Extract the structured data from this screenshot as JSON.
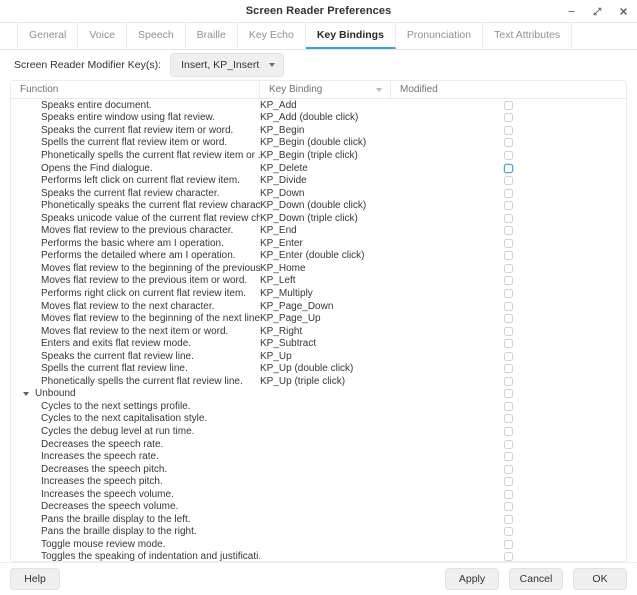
{
  "window": {
    "title": "Screen Reader Preferences",
    "controls": [
      {
        "name": "minimize-button",
        "glyph": "−"
      },
      {
        "name": "maximize-button",
        "glyph": "⤡"
      },
      {
        "name": "close-button",
        "glyph": "✕"
      }
    ]
  },
  "tabs": [
    {
      "label": "General",
      "active": false
    },
    {
      "label": "Voice",
      "active": false
    },
    {
      "label": "Speech",
      "active": false
    },
    {
      "label": "Braille",
      "active": false
    },
    {
      "label": "Key Echo",
      "active": false
    },
    {
      "label": "Key Bindings",
      "active": true
    },
    {
      "label": "Pronunciation",
      "active": false
    },
    {
      "label": "Text Attributes",
      "active": false
    }
  ],
  "modifier": {
    "label": "Screen Reader Modifier Key(s):",
    "value": "Insert, KP_Insert"
  },
  "table": {
    "headers": {
      "function": "Function",
      "key_binding": "Key Binding",
      "modified": "Modified"
    },
    "sort_column": "Key Binding",
    "sort_direction": "descending",
    "rows": [
      {
        "function": "Speaks entire document.",
        "key": "KP_Add",
        "modified": false
      },
      {
        "function": "Speaks entire window using flat review.",
        "key": "KP_Add (double click)",
        "modified": false
      },
      {
        "function": "Speaks the current flat review item or word.",
        "key": "KP_Begin",
        "modified": false
      },
      {
        "function": "Spells the current flat review item or word.",
        "key": "KP_Begin (double click)",
        "modified": false
      },
      {
        "function": "Phonetically spells the current flat review item or ...",
        "key": "KP_Begin (triple click)",
        "modified": false
      },
      {
        "function": "Opens the Find dialogue.",
        "key": "KP_Delete",
        "modified": false,
        "focused": true
      },
      {
        "function": "Performs left click on current flat review item.",
        "key": "KP_Divide",
        "modified": false
      },
      {
        "function": "Speaks the current flat review character.",
        "key": "KP_Down",
        "modified": false
      },
      {
        "function": "Phonetically speaks the current flat review charact...",
        "key": "KP_Down (double click)",
        "modified": false
      },
      {
        "function": "Speaks unicode value of the current flat review ch...",
        "key": "KP_Down (triple click)",
        "modified": false
      },
      {
        "function": "Moves flat review to the previous character.",
        "key": "KP_End",
        "modified": false
      },
      {
        "function": "Performs the basic where am I operation.",
        "key": "KP_Enter",
        "modified": false
      },
      {
        "function": "Performs the detailed where am I operation.",
        "key": "KP_Enter (double click)",
        "modified": false
      },
      {
        "function": "Moves flat review to the beginning of the previous ...",
        "key": "KP_Home",
        "modified": false
      },
      {
        "function": "Moves flat review to the previous item or word.",
        "key": "KP_Left",
        "modified": false
      },
      {
        "function": "Performs right click on current flat review item.",
        "key": "KP_Multiply",
        "modified": false
      },
      {
        "function": "Moves flat review to the next character.",
        "key": "KP_Page_Down",
        "modified": false
      },
      {
        "function": "Moves flat review to the beginning of the next line.",
        "key": "KP_Page_Up",
        "modified": false
      },
      {
        "function": "Moves flat review to the next item or word.",
        "key": "KP_Right",
        "modified": false
      },
      {
        "function": "Enters and exits flat review mode.",
        "key": "KP_Subtract",
        "modified": false
      },
      {
        "function": "Speaks the current flat review line.",
        "key": "KP_Up",
        "modified": false
      },
      {
        "function": "Spells the current flat review line.",
        "key": "KP_Up (double click)",
        "modified": false
      },
      {
        "function": "Phonetically spells the current flat review line.",
        "key": "KP_Up (triple click)",
        "modified": false
      },
      {
        "group": true,
        "expanded": true,
        "function": "Unbound",
        "key": "",
        "modified": false
      },
      {
        "function": "Cycles to the next settings profile.",
        "key": "",
        "modified": false
      },
      {
        "function": "Cycles to the next capitalisation style.",
        "key": "",
        "modified": false
      },
      {
        "function": "Cycles the debug level at run time.",
        "key": "",
        "modified": false
      },
      {
        "function": "Decreases the speech rate.",
        "key": "",
        "modified": false
      },
      {
        "function": "Increases the speech rate.",
        "key": "",
        "modified": false
      },
      {
        "function": "Decreases the speech pitch.",
        "key": "",
        "modified": false
      },
      {
        "function": "Increases the speech pitch.",
        "key": "",
        "modified": false
      },
      {
        "function": "Increases the speech volume.",
        "key": "",
        "modified": false
      },
      {
        "function": "Decreases the speech volume.",
        "key": "",
        "modified": false
      },
      {
        "function": "Pans the braille display to the left.",
        "key": "",
        "modified": false
      },
      {
        "function": "Pans the braille display to the right.",
        "key": "",
        "modified": false
      },
      {
        "function": "Toggle mouse review mode.",
        "key": "",
        "modified": false
      },
      {
        "function": "Toggles the speaking of indentation and justificati...",
        "key": "",
        "modified": false
      }
    ]
  },
  "footer": {
    "help": "Help",
    "apply": "Apply",
    "cancel": "Cancel",
    "ok": "OK"
  },
  "colors": {
    "accent": "#3ba3d0",
    "focus_ring": "#4aa3cc",
    "text": "#2e3436",
    "muted_text": "#8f9293",
    "button_bg": "#efeff0"
  }
}
